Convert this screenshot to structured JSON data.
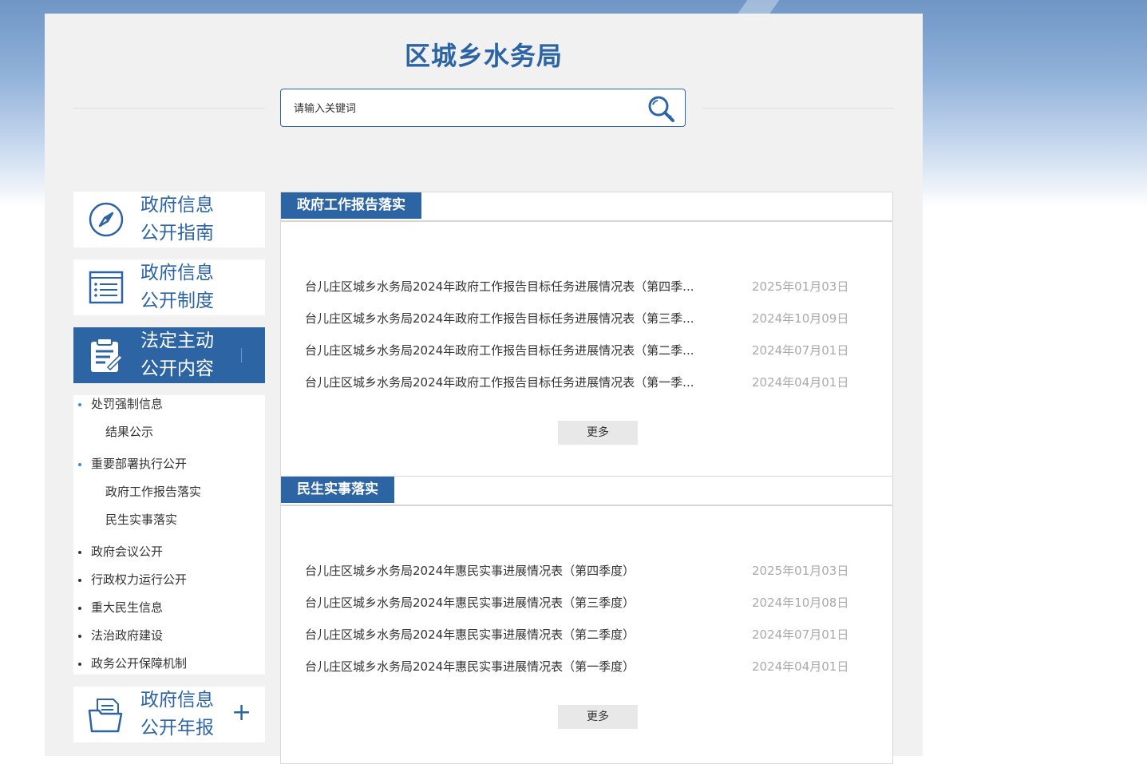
{
  "site": {
    "title": "区城乡水务局"
  },
  "search": {
    "placeholder": "请输入关键词",
    "value": ""
  },
  "nav": {
    "guide": {
      "line1": "政府信息",
      "line2": "公开指南",
      "icon": "compass-icon"
    },
    "system": {
      "line1": "政府信息",
      "line2": "公开制度",
      "icon": "list-document-icon"
    },
    "statutory": {
      "line1": "法定主动",
      "line2": "公开内容",
      "icon": "clipboard-edit-icon"
    },
    "annual": {
      "line1": "政府信息",
      "line2": "公开年报",
      "icon": "folder-report-icon",
      "expand": "+"
    }
  },
  "submenu": [
    {
      "label": "处罚强制信息",
      "level": 1,
      "bullet": "blue"
    },
    {
      "label": "结果公示",
      "level": 2
    },
    {
      "label": "重要部署执行公开",
      "level": 1,
      "bullet": "blue"
    },
    {
      "label": "政府工作报告落实",
      "level": 2
    },
    {
      "label": "民生实事落实",
      "level": 2
    },
    {
      "label": "政府会议公开",
      "level": 1,
      "bullet": "dark"
    },
    {
      "label": "行政权力运行公开",
      "level": 1,
      "bullet": "dark"
    },
    {
      "label": "重大民生信息",
      "level": 1,
      "bullet": "dark"
    },
    {
      "label": "法治政府建设",
      "level": 1,
      "bullet": "dark"
    },
    {
      "label": "政务公开保障机制",
      "level": 1,
      "bullet": "dark"
    }
  ],
  "sections": [
    {
      "title": "政府工作报告落实",
      "more": "更多",
      "items": [
        {
          "title": "台儿庄区城乡水务局2024年政府工作报告目标任务进展情况表（第四季...",
          "date": "2025年01月03日"
        },
        {
          "title": "台儿庄区城乡水务局2024年政府工作报告目标任务进展情况表（第三季...",
          "date": "2024年10月09日"
        },
        {
          "title": "台儿庄区城乡水务局2024年政府工作报告目标任务进展情况表（第二季...",
          "date": "2024年07月01日"
        },
        {
          "title": "台儿庄区城乡水务局2024年政府工作报告目标任务进展情况表（第一季...",
          "date": "2024年04月01日"
        }
      ]
    },
    {
      "title": "民生实事落实",
      "more": "更多",
      "items": [
        {
          "title": "台儿庄区城乡水务局2024年惠民实事进展情况表（第四季度）",
          "date": "2025年01月03日"
        },
        {
          "title": "台儿庄区城乡水务局2024年惠民实事进展情况表（第三季度）",
          "date": "2024年10月08日"
        },
        {
          "title": "台儿庄区城乡水务局2024年惠民实事进展情况表（第二季度）",
          "date": "2024年07月01日"
        },
        {
          "title": "台儿庄区城乡水务局2024年惠民实事进展情况表（第一季度）",
          "date": "2024年04月01日"
        }
      ]
    }
  ],
  "colors": {
    "brand": "#2c64a4",
    "date": "#a9a9a9",
    "panel": "#f1f1f1"
  }
}
